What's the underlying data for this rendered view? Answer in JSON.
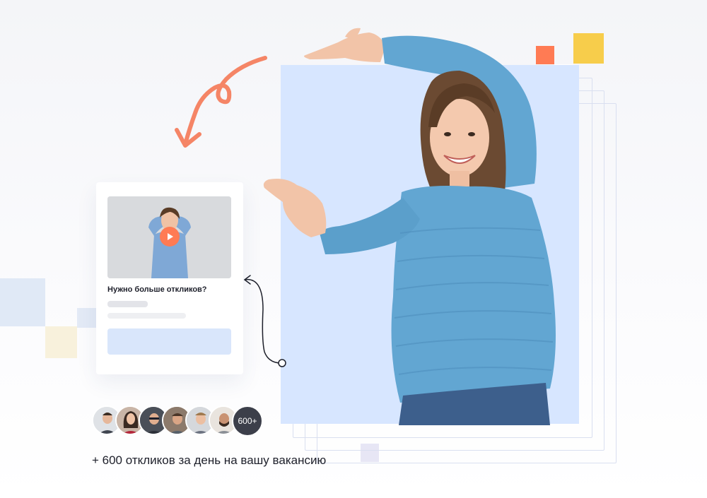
{
  "card": {
    "title": "Нужно больше откликов?"
  },
  "avatars": {
    "count_label": "600+"
  },
  "caption": "+ 600 откликов за день на вашу вакансию",
  "colors": {
    "photo_bg": "#d7e6ff",
    "accent_orange": "#ff7b54",
    "accent_yellow": "#f7cd4b",
    "sweater_blue": "#62a6d2",
    "cta_skeleton": "#d9e6fb"
  }
}
